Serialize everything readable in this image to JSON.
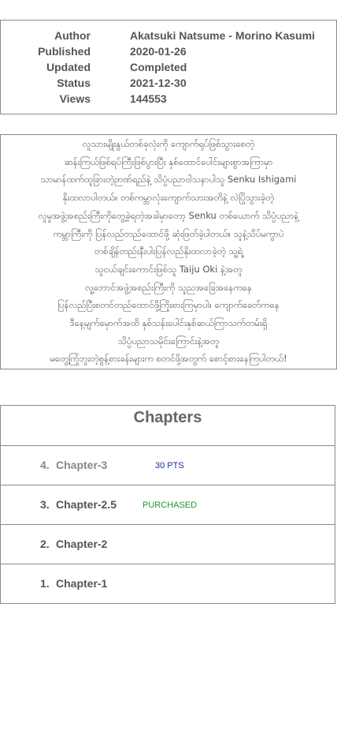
{
  "info": {
    "rows": [
      {
        "label": "Author",
        "value": "Akatsuki Natsume - Morino Kasumi"
      },
      {
        "label": "Published",
        "value": "2020-01-26"
      },
      {
        "label": "Updated",
        "value": "Completed"
      },
      {
        "label": "Status",
        "value": "2021-12-30"
      },
      {
        "label": "Views",
        "value": "144553"
      }
    ]
  },
  "description": {
    "lines": [
      "လူသားမျိုးနွယ်တစ်ခုလုံးကို ကျောက်ရုပ်ဖြစ်သွားစေတဲ့",
      "ဆန်းကြယ်ဖြစ်ရပ်ကြီးဖြစ်ပွားပြီး နှစ်ထောင်ပေါင်းများစွာအကြာမှာ",
      "သာမာန်ထက်ထူခြားတဲ့ဉာဏ်ရည်နဲ့ သိပ္ပံပညာဝါသနာပါသူ Senku Ishigami",
      "နိုးထလာပါတယ်။ တစ်ကမ္ဘာလုံးကျောက်သားအတိနဲ့ လဲပြိုသွားခဲ့တဲ့",
      "လူမှုအဖွဲ့အစည်းကြီးကိုတွေ့ခဲ့ရတဲ့အခါမှာတော့ Senku တစ်ယောက် သိပ္ပံပညာနဲ့",
      "ကမ္ဘာကြီးကို ပြန်လည်တည်ထောင်ဖို့ ဆုံးဖြတ်ခဲ့ပါတယ်။ သူနဲ့သိပ်မကွာပဲ",
      "တစ်ချိန်တည်းနီးပါးပြန်လည်နိုးထလာခဲ့တဲ့ သူ့ရဲ့",
      "သူငယ်ချင်းကောင်းဖြစ်သူ Taiju Oki နဲ့အတူ",
      "လူ့ဘောင်အဖွဲ့အစည်းကြီးကို သူညအခြေအနေကနေ",
      "ပြန်လည်ပြီးစတင်တည်ထောင်ဖို့ကြိုးစားကြမှာပါ။ ကျောက်ခေတ်ကနေ",
      "ဒီနေ့မျက်မှောက်အထိ နှစ်သန်းပေါင်းနှစ်ဆယ်ကြာသက်တမ်းရှိ",
      "သိပ္ပံပညာသမိုင်းကြောင်းနဲ့အတူ",
      "မတွေ့ကြုံဘူးတဲ့စွန့်စားခန်းများက စတင်ဖို့အတွက် စောင့်စားနေကြပါတယ်!"
    ]
  },
  "chapters": {
    "title": "Chapters",
    "items": [
      {
        "num": "4.",
        "title": "Chapter-3",
        "badge": "30 PTS"
      },
      {
        "num": "3.",
        "title": "Chapter-2.5",
        "badge": "PURCHASED"
      },
      {
        "num": "2.",
        "title": "Chapter-2",
        "badge": ""
      },
      {
        "num": "1.",
        "title": "Chapter-1",
        "badge": ""
      }
    ]
  },
  "colors": {
    "points_badge": "#1d2fa6",
    "purchased_badge": "#1a9a2a",
    "border": "#8a8a8a"
  }
}
